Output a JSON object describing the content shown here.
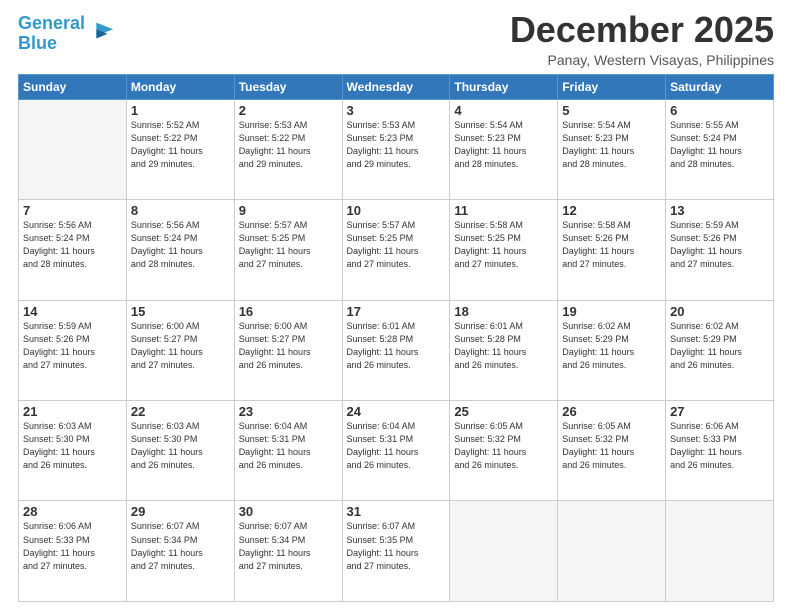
{
  "logo": {
    "line1": "General",
    "line2": "Blue"
  },
  "title": "December 2025",
  "location": "Panay, Western Visayas, Philippines",
  "weekdays": [
    "Sunday",
    "Monday",
    "Tuesday",
    "Wednesday",
    "Thursday",
    "Friday",
    "Saturday"
  ],
  "weeks": [
    [
      {
        "day": "",
        "info": ""
      },
      {
        "day": "1",
        "info": "Sunrise: 5:52 AM\nSunset: 5:22 PM\nDaylight: 11 hours\nand 29 minutes."
      },
      {
        "day": "2",
        "info": "Sunrise: 5:53 AM\nSunset: 5:22 PM\nDaylight: 11 hours\nand 29 minutes."
      },
      {
        "day": "3",
        "info": "Sunrise: 5:53 AM\nSunset: 5:23 PM\nDaylight: 11 hours\nand 29 minutes."
      },
      {
        "day": "4",
        "info": "Sunrise: 5:54 AM\nSunset: 5:23 PM\nDaylight: 11 hours\nand 28 minutes."
      },
      {
        "day": "5",
        "info": "Sunrise: 5:54 AM\nSunset: 5:23 PM\nDaylight: 11 hours\nand 28 minutes."
      },
      {
        "day": "6",
        "info": "Sunrise: 5:55 AM\nSunset: 5:24 PM\nDaylight: 11 hours\nand 28 minutes."
      }
    ],
    [
      {
        "day": "7",
        "info": "Sunrise: 5:56 AM\nSunset: 5:24 PM\nDaylight: 11 hours\nand 28 minutes."
      },
      {
        "day": "8",
        "info": "Sunrise: 5:56 AM\nSunset: 5:24 PM\nDaylight: 11 hours\nand 28 minutes."
      },
      {
        "day": "9",
        "info": "Sunrise: 5:57 AM\nSunset: 5:25 PM\nDaylight: 11 hours\nand 27 minutes."
      },
      {
        "day": "10",
        "info": "Sunrise: 5:57 AM\nSunset: 5:25 PM\nDaylight: 11 hours\nand 27 minutes."
      },
      {
        "day": "11",
        "info": "Sunrise: 5:58 AM\nSunset: 5:25 PM\nDaylight: 11 hours\nand 27 minutes."
      },
      {
        "day": "12",
        "info": "Sunrise: 5:58 AM\nSunset: 5:26 PM\nDaylight: 11 hours\nand 27 minutes."
      },
      {
        "day": "13",
        "info": "Sunrise: 5:59 AM\nSunset: 5:26 PM\nDaylight: 11 hours\nand 27 minutes."
      }
    ],
    [
      {
        "day": "14",
        "info": "Sunrise: 5:59 AM\nSunset: 5:26 PM\nDaylight: 11 hours\nand 27 minutes."
      },
      {
        "day": "15",
        "info": "Sunrise: 6:00 AM\nSunset: 5:27 PM\nDaylight: 11 hours\nand 27 minutes."
      },
      {
        "day": "16",
        "info": "Sunrise: 6:00 AM\nSunset: 5:27 PM\nDaylight: 11 hours\nand 26 minutes."
      },
      {
        "day": "17",
        "info": "Sunrise: 6:01 AM\nSunset: 5:28 PM\nDaylight: 11 hours\nand 26 minutes."
      },
      {
        "day": "18",
        "info": "Sunrise: 6:01 AM\nSunset: 5:28 PM\nDaylight: 11 hours\nand 26 minutes."
      },
      {
        "day": "19",
        "info": "Sunrise: 6:02 AM\nSunset: 5:29 PM\nDaylight: 11 hours\nand 26 minutes."
      },
      {
        "day": "20",
        "info": "Sunrise: 6:02 AM\nSunset: 5:29 PM\nDaylight: 11 hours\nand 26 minutes."
      }
    ],
    [
      {
        "day": "21",
        "info": "Sunrise: 6:03 AM\nSunset: 5:30 PM\nDaylight: 11 hours\nand 26 minutes."
      },
      {
        "day": "22",
        "info": "Sunrise: 6:03 AM\nSunset: 5:30 PM\nDaylight: 11 hours\nand 26 minutes."
      },
      {
        "day": "23",
        "info": "Sunrise: 6:04 AM\nSunset: 5:31 PM\nDaylight: 11 hours\nand 26 minutes."
      },
      {
        "day": "24",
        "info": "Sunrise: 6:04 AM\nSunset: 5:31 PM\nDaylight: 11 hours\nand 26 minutes."
      },
      {
        "day": "25",
        "info": "Sunrise: 6:05 AM\nSunset: 5:32 PM\nDaylight: 11 hours\nand 26 minutes."
      },
      {
        "day": "26",
        "info": "Sunrise: 6:05 AM\nSunset: 5:32 PM\nDaylight: 11 hours\nand 26 minutes."
      },
      {
        "day": "27",
        "info": "Sunrise: 6:06 AM\nSunset: 5:33 PM\nDaylight: 11 hours\nand 26 minutes."
      }
    ],
    [
      {
        "day": "28",
        "info": "Sunrise: 6:06 AM\nSunset: 5:33 PM\nDaylight: 11 hours\nand 27 minutes."
      },
      {
        "day": "29",
        "info": "Sunrise: 6:07 AM\nSunset: 5:34 PM\nDaylight: 11 hours\nand 27 minutes."
      },
      {
        "day": "30",
        "info": "Sunrise: 6:07 AM\nSunset: 5:34 PM\nDaylight: 11 hours\nand 27 minutes."
      },
      {
        "day": "31",
        "info": "Sunrise: 6:07 AM\nSunset: 5:35 PM\nDaylight: 11 hours\nand 27 minutes."
      },
      {
        "day": "",
        "info": ""
      },
      {
        "day": "",
        "info": ""
      },
      {
        "day": "",
        "info": ""
      }
    ]
  ]
}
